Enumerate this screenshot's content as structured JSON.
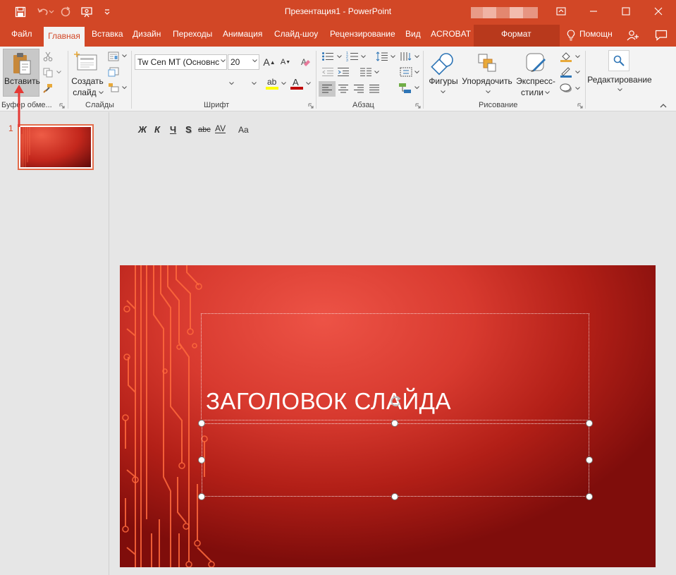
{
  "window": {
    "title": "Презентация1 - PowerPoint"
  },
  "tabs": {
    "file": "Файл",
    "home": "Главная",
    "insert": "Вставка",
    "design": "Дизайн",
    "transitions": "Переходы",
    "animations": "Анимация",
    "slideshow": "Слайд-шоу",
    "review": "Рецензирование",
    "view": "Вид",
    "acrobat": "ACROBAT",
    "format": "Формат",
    "tell_me": "Помощн"
  },
  "ribbon": {
    "clipboard": {
      "paste_label": "Вставить",
      "group_label": "Буфер обме..."
    },
    "slides": {
      "new_slide_line1": "Создать",
      "new_slide_line2": "слайд",
      "group_label": "Слайды"
    },
    "font": {
      "font_name": "Tw Cen MT (Основнс",
      "font_size": "20",
      "bold": "Ж",
      "italic": "К",
      "underline": "Ч",
      "shadow": "S",
      "strike": "abc",
      "spacing": "AV",
      "change_case": "Aa",
      "grow": "A",
      "shrink": "A",
      "group_label": "Шрифт"
    },
    "paragraph": {
      "group_label": "Абзац"
    },
    "drawing": {
      "shapes": "Фигуры",
      "arrange": "Упорядочить",
      "quick_styles_line1": "Экспресс-",
      "quick_styles_line2": "стили",
      "group_label": "Рисование"
    },
    "editing": {
      "label": "Редактирование"
    }
  },
  "thumbnails": {
    "slide_number": "1"
  },
  "slide": {
    "title": "ЗАГОЛОВОК СЛАЙДА"
  },
  "colors": {
    "accent": "#d24726",
    "ribbon_bg": "#f3f3f3",
    "slide_red": "#d83a2f",
    "circuit": "#ff6a3d",
    "annotation_arrow": "#e53935"
  },
  "icons": [
    "save-icon",
    "undo-icon",
    "redo-icon",
    "present-icon",
    "customize-icon",
    "ribbon-display-icon",
    "minimize-icon",
    "maximize-icon",
    "close-icon",
    "lightbulb-icon",
    "share-icon",
    "comments-icon"
  ]
}
